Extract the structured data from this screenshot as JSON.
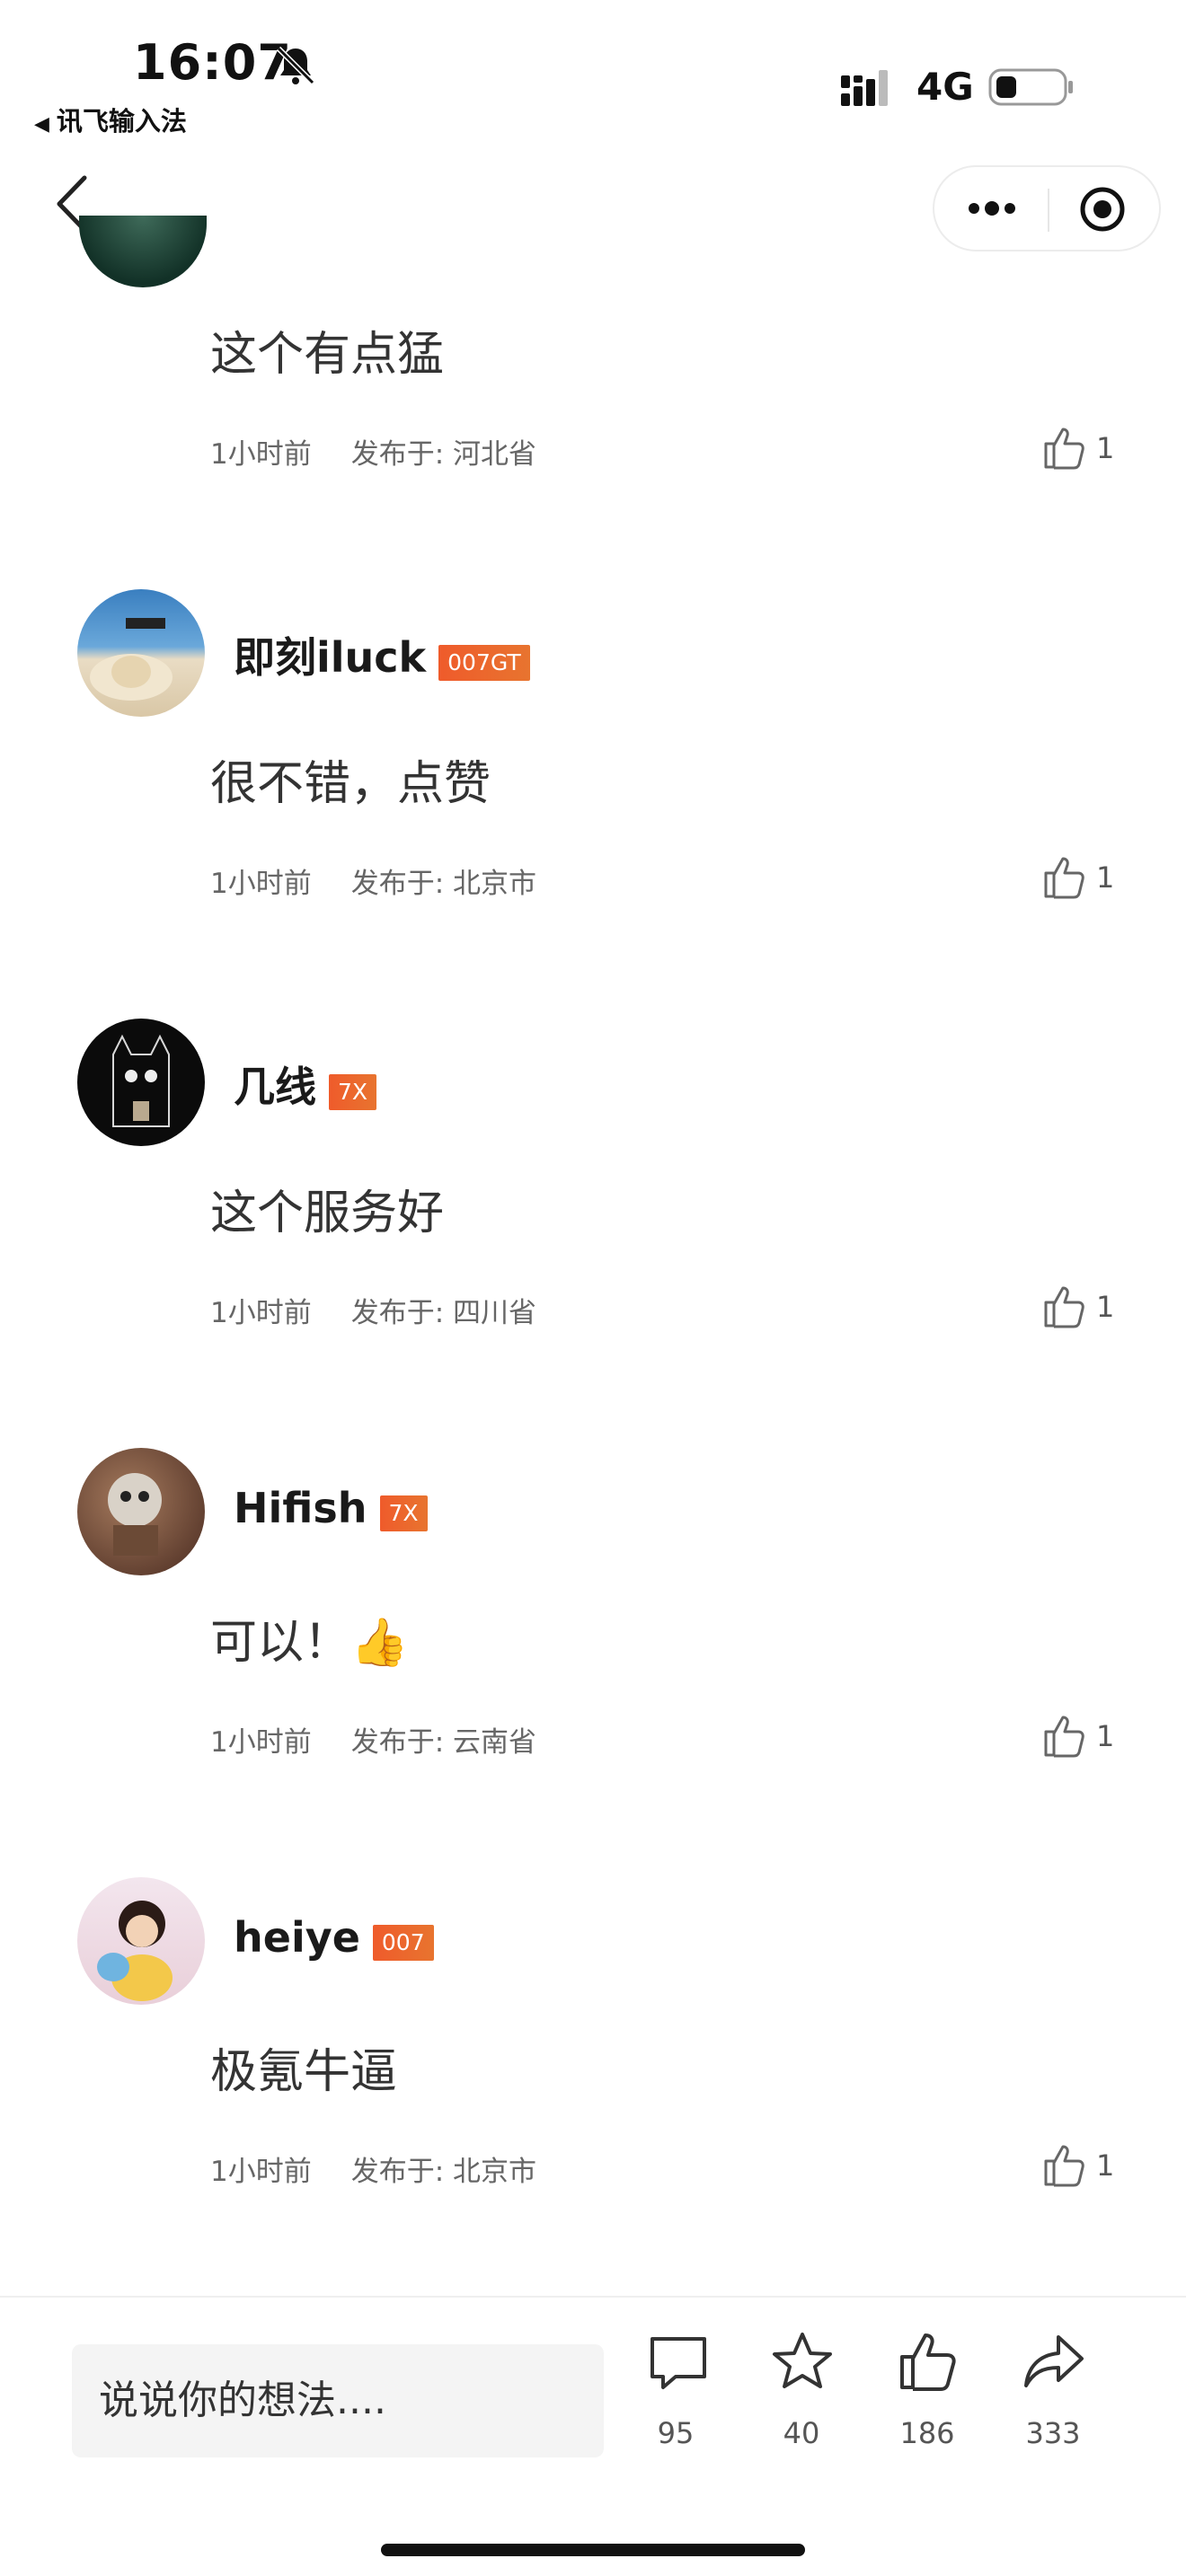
{
  "status_bar": {
    "time": "16:07",
    "back_app_label": "讯飞输入法",
    "network": "4G"
  },
  "comments": [
    {
      "partial": true,
      "text": "这个有点猛",
      "time": "1小时前",
      "location": "发布于: 河北省",
      "likes": "1"
    },
    {
      "username": "即刻iluck",
      "badge": "007GT",
      "text": "很不错，点赞",
      "time": "1小时前",
      "location": "发布于: 北京市",
      "likes": "1"
    },
    {
      "username": "几线",
      "badge": "7X",
      "text": "这个服务好",
      "time": "1小时前",
      "location": "发布于: 四川省",
      "likes": "1"
    },
    {
      "username": "Hifish",
      "badge": "7X",
      "text": "可以！👍",
      "time": "1小时前",
      "location": "发布于: 云南省",
      "likes": "1"
    },
    {
      "username": "heiye",
      "badge": "007",
      "text": "极氪牛逼",
      "time": "1小时前",
      "location": "发布于: 北京市",
      "likes": "1"
    }
  ],
  "bottom_bar": {
    "input_placeholder": "说说你的想法....",
    "comments_count": "95",
    "favorites_count": "40",
    "likes_count": "186",
    "shares_count": "333"
  },
  "colors": {
    "badge": "#ec5f2c",
    "text_primary": "#1a1a1a",
    "text_secondary": "#666666"
  }
}
